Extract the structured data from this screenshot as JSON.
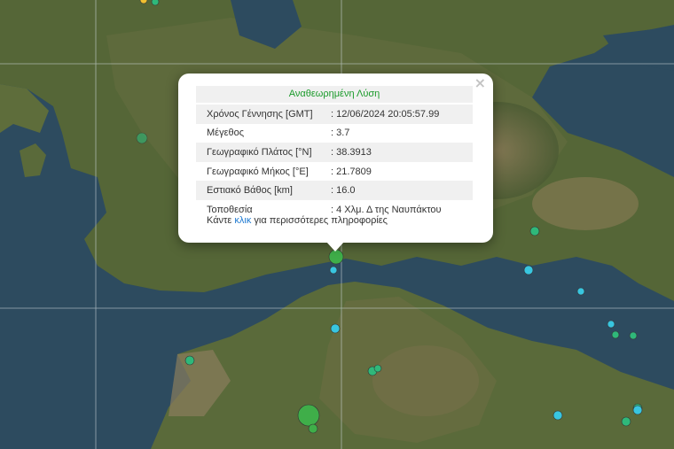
{
  "popup": {
    "title": "Αναθεωρημένη Λύση",
    "close_glyph": "×",
    "rows": [
      {
        "label": "Χρόνος Γέννησης [GMT]",
        "value": ": 12/06/2024 20:05:57.99"
      },
      {
        "label": "Μέγεθος",
        "value": ": 3.7"
      },
      {
        "label": "Γεωγραφικό Πλάτος [°N]",
        "value": ": 38.3913"
      },
      {
        "label": "Γεωγραφικό Μήκος [°E]",
        "value": ": 21.7809"
      },
      {
        "label": "Εστιακό Βάθος [km]",
        "value": ": 16.0"
      },
      {
        "label": "Τοποθεσία",
        "value": ": 4 Χλμ. Δ της Ναυπάκτου"
      }
    ],
    "more_prefix": "Κάντε ",
    "more_link": "κλικ",
    "more_suffix": " για περισσότερες πληροφορίες"
  },
  "legend_colors": {
    "selected_event": "#3fae49",
    "recent_event": "#2fb87a",
    "older_event": "#38c6e0",
    "top_event": "#f0c030"
  }
}
